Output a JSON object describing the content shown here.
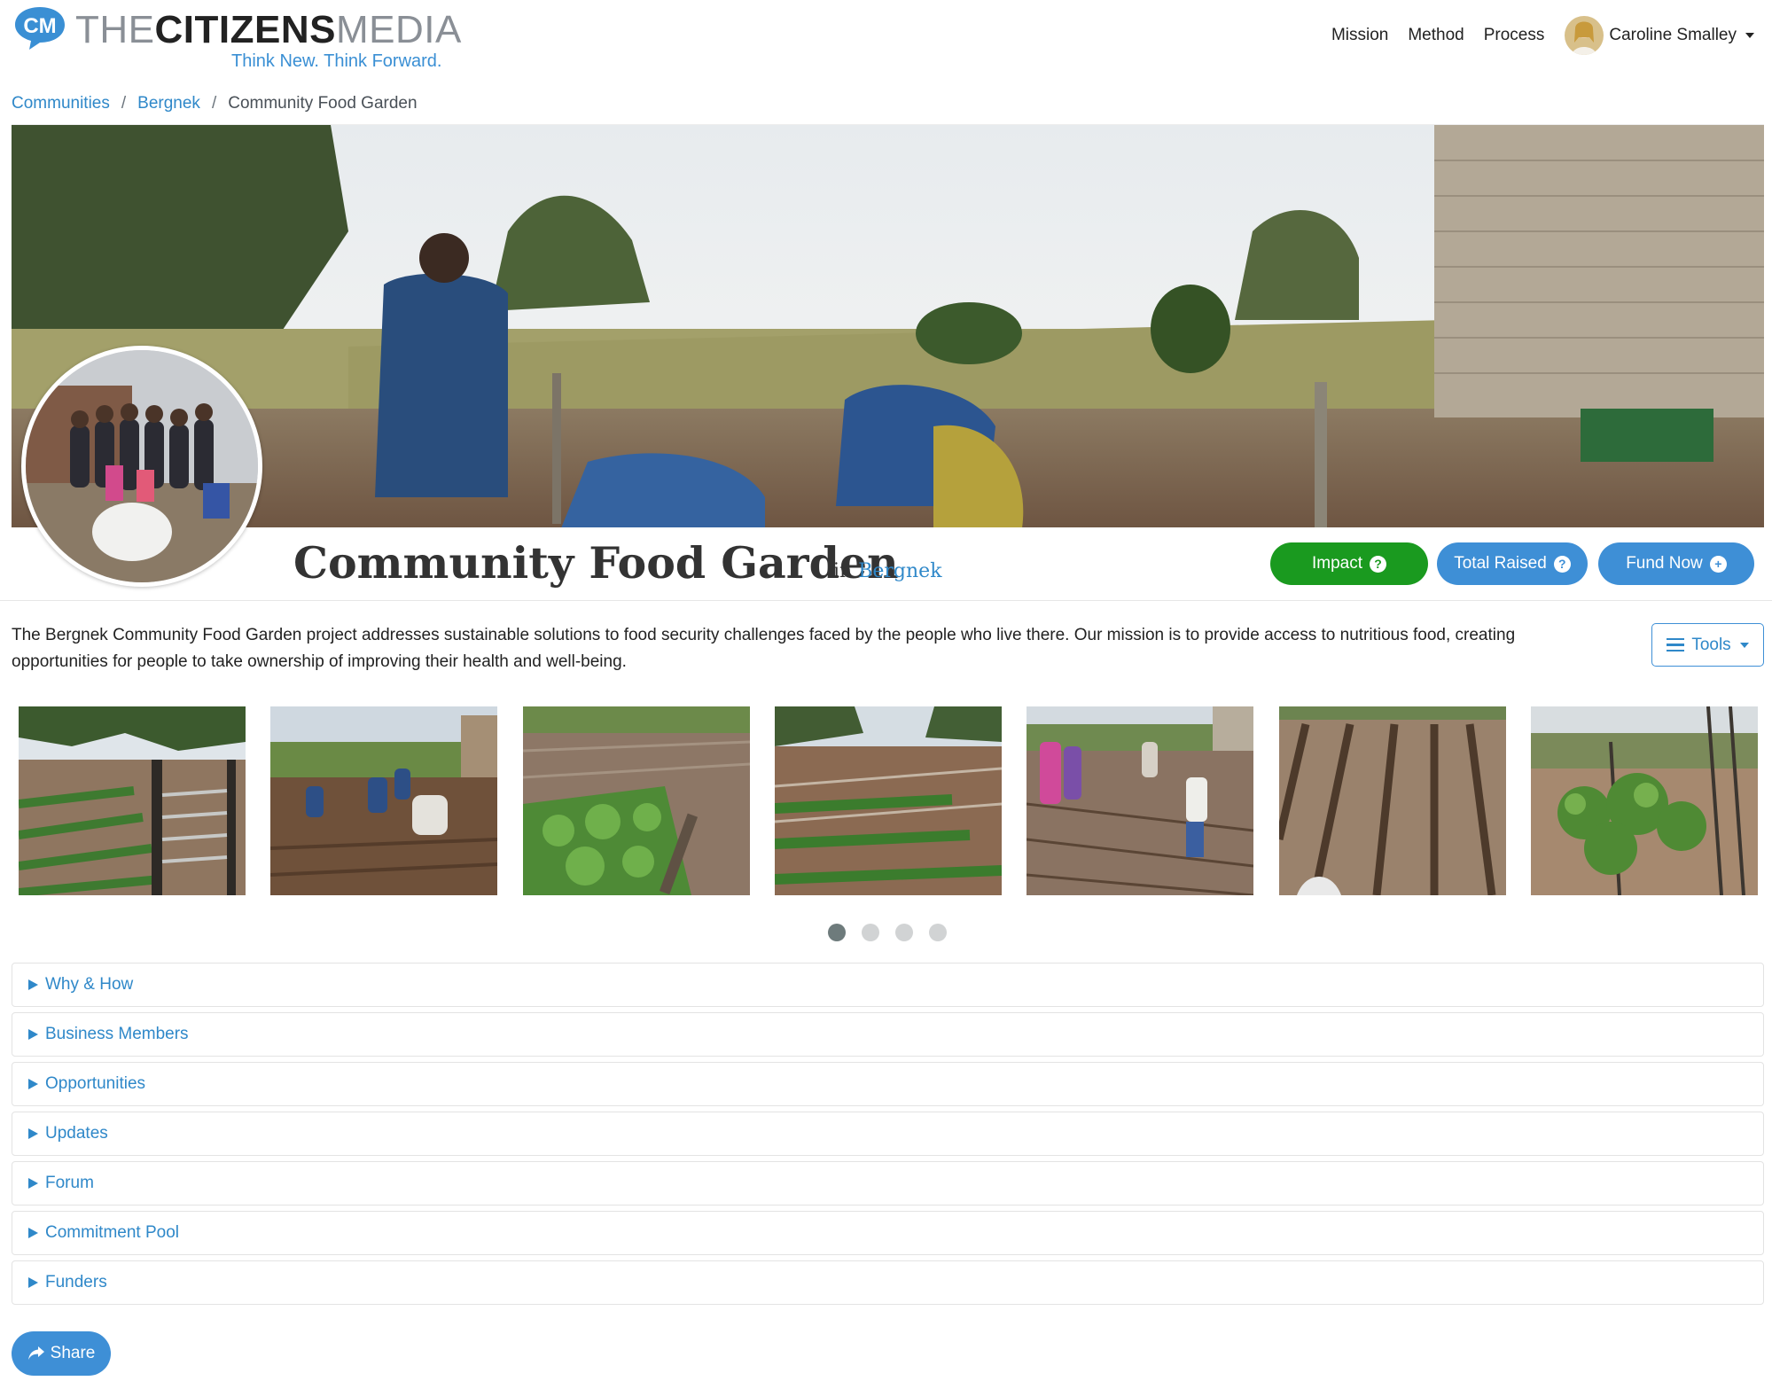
{
  "brand": {
    "badge": "CM",
    "name_part1": "THE",
    "name_part2": "CITIZENS",
    "name_part3": "MEDIA",
    "tagline": "Think New. Think Forward."
  },
  "nav": {
    "links": [
      "Mission",
      "Method",
      "Process"
    ],
    "user_name": "Caroline Smalley"
  },
  "breadcrumb": {
    "items": [
      "Communities",
      "Bergnek"
    ],
    "current": "Community Food Garden",
    "separator": "/"
  },
  "project": {
    "title": "Community Food Garden",
    "in_label": "in",
    "community": "Bergnek",
    "description": "The Bergnek Community Food Garden project addresses sustainable solutions to food security challenges faced by the people who live there. Our mission is to provide access to nutritious food, creating opportunities for people to take ownership of improving their health and well-being."
  },
  "actions": {
    "impact": "Impact",
    "total_raised": "Total Raised",
    "fund_now": "Fund Now",
    "tools": "Tools",
    "share": "Share"
  },
  "gallery": {
    "thumbnail_count": 7,
    "dots": 4,
    "active_dot": 0
  },
  "sections": [
    "Why & How",
    "Business Members",
    "Opportunities",
    "Updates",
    "Forum",
    "Commitment Pool",
    "Funders"
  ],
  "colors": {
    "primary": "#3e8fd6",
    "link": "#2f88c9",
    "impact_green": "#1a9a1f"
  }
}
